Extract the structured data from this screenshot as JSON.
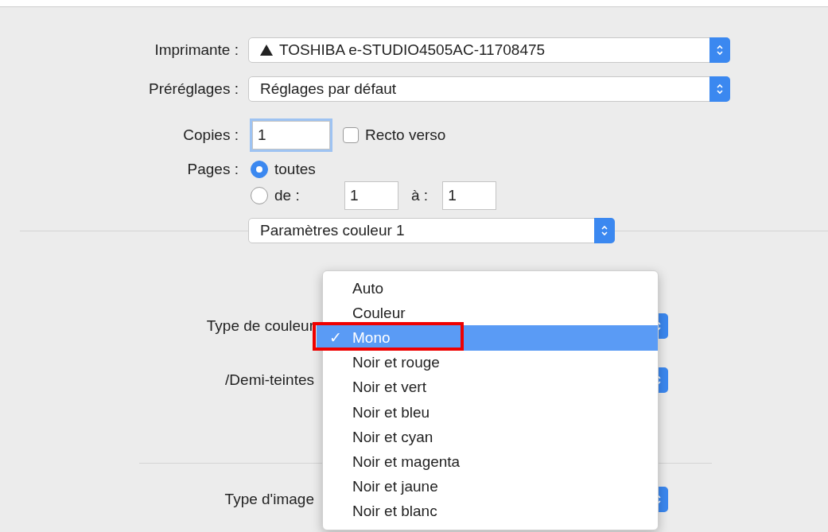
{
  "printer": {
    "label": "Imprimante :",
    "value": "TOSHIBA e-STUDIO4505AC-11708475"
  },
  "presets": {
    "label": "Préréglages :",
    "value": "Réglages par défaut"
  },
  "copies": {
    "label": "Copies :",
    "value": "1",
    "duplex": {
      "label": "Recto verso",
      "checked": false
    }
  },
  "pages": {
    "label": "Pages :",
    "options": [
      {
        "label": "toutes",
        "selected": true
      },
      {
        "label": "de :",
        "selected": false
      }
    ],
    "from": "1",
    "to_label": "à :",
    "to": "1"
  },
  "section_popup": {
    "value": "Paramètres couleur 1"
  },
  "settings": [
    {
      "label": "Type de couleur"
    },
    {
      "label": "/Demi-teintes"
    },
    {
      "label": "Type d'image"
    }
  ],
  "color_menu": {
    "check_mark": "✓",
    "items": [
      {
        "label": "Auto",
        "selected": false
      },
      {
        "label": "Couleur",
        "selected": false
      },
      {
        "label": "Mono",
        "selected": true
      },
      {
        "label": "Noir et rouge",
        "selected": false
      },
      {
        "label": "Noir et vert",
        "selected": false
      },
      {
        "label": "Noir et bleu",
        "selected": false
      },
      {
        "label": "Noir et cyan",
        "selected": false
      },
      {
        "label": "Noir et magenta",
        "selected": false
      },
      {
        "label": "Noir et jaune",
        "selected": false
      },
      {
        "label": "Noir et blanc",
        "selected": false
      }
    ]
  }
}
